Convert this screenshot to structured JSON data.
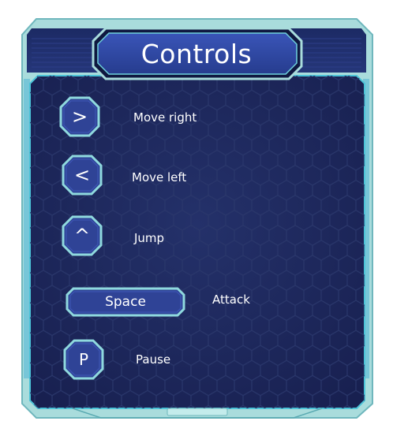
{
  "panel": {
    "title": "Controls"
  },
  "controls": [
    {
      "key": ">",
      "action": "Move right"
    },
    {
      "key": "<",
      "action": "Move left"
    },
    {
      "key": "^",
      "action": "Jump"
    },
    {
      "key": "Space",
      "action": "Attack"
    },
    {
      "key": "P",
      "action": "Pause"
    }
  ],
  "colors": {
    "frame_outer": "#9fd6d6",
    "frame_inner_border": "#5ec8d4",
    "panel_background": "#1f2a5a",
    "key_fill": "#2f4396",
    "key_border": "#8fd9de"
  }
}
